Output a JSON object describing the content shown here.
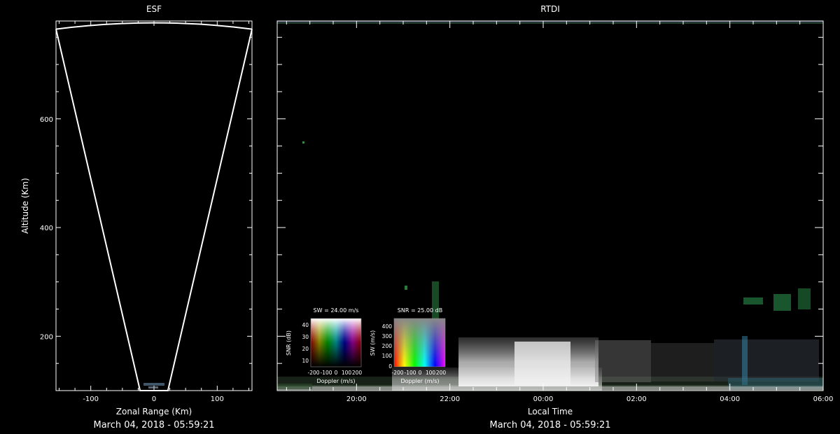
{
  "chart_data": [
    {
      "type": "scatter",
      "title": "ESF",
      "xlabel": "Zonal Range (Km)",
      "ylabel": "Altitude (Km)",
      "footer": "March 04, 2018 - 05:59:21",
      "xlim": [
        -155,
        155
      ],
      "ylim": [
        100,
        780
      ],
      "xticks": [
        -100,
        0,
        100
      ],
      "yticks": [
        200,
        400,
        600
      ],
      "beam_outline": {
        "left_bottom": [
          -22,
          100
        ],
        "right_bottom": [
          22,
          100
        ],
        "left_top": [
          -155,
          765
        ],
        "right_top": [
          155,
          765
        ],
        "apex_alt": 778
      }
    },
    {
      "type": "heatmap",
      "title": "RTDI",
      "xlabel": "Local Time",
      "footer": "March 04, 2018 - 05:59:21",
      "xlim": [
        18.3,
        30
      ],
      "ylim": [
        100,
        780
      ],
      "xticks": [
        {
          "value": 20,
          "label": "20:00"
        },
        {
          "value": 22,
          "label": "22:00"
        },
        {
          "value": 24,
          "label": "00:00"
        },
        {
          "value": 26,
          "label": "02:00"
        },
        {
          "value": 28,
          "label": "04:00"
        },
        {
          "value": 30,
          "label": "06:00"
        }
      ],
      "yticks": [
        200,
        400,
        600
      ]
    }
  ],
  "legends": [
    {
      "title": "SW = 24.00 m/s",
      "xlabel": "Doppler (m/s)",
      "ylabel": "SNR (dB)",
      "xticks": [
        "-200",
        "-100",
        "0",
        "100",
        "200"
      ],
      "yticks": [
        "10",
        "20",
        "30",
        "40"
      ]
    },
    {
      "title": "SNR = 25.00 dB",
      "xlabel": "Doppler (m/s)",
      "ylabel": "SW (m/s)",
      "xticks": [
        "-200",
        "-100",
        "0",
        "100",
        "200"
      ],
      "yticks": [
        "0",
        "100",
        "200",
        "300",
        "400"
      ]
    }
  ]
}
